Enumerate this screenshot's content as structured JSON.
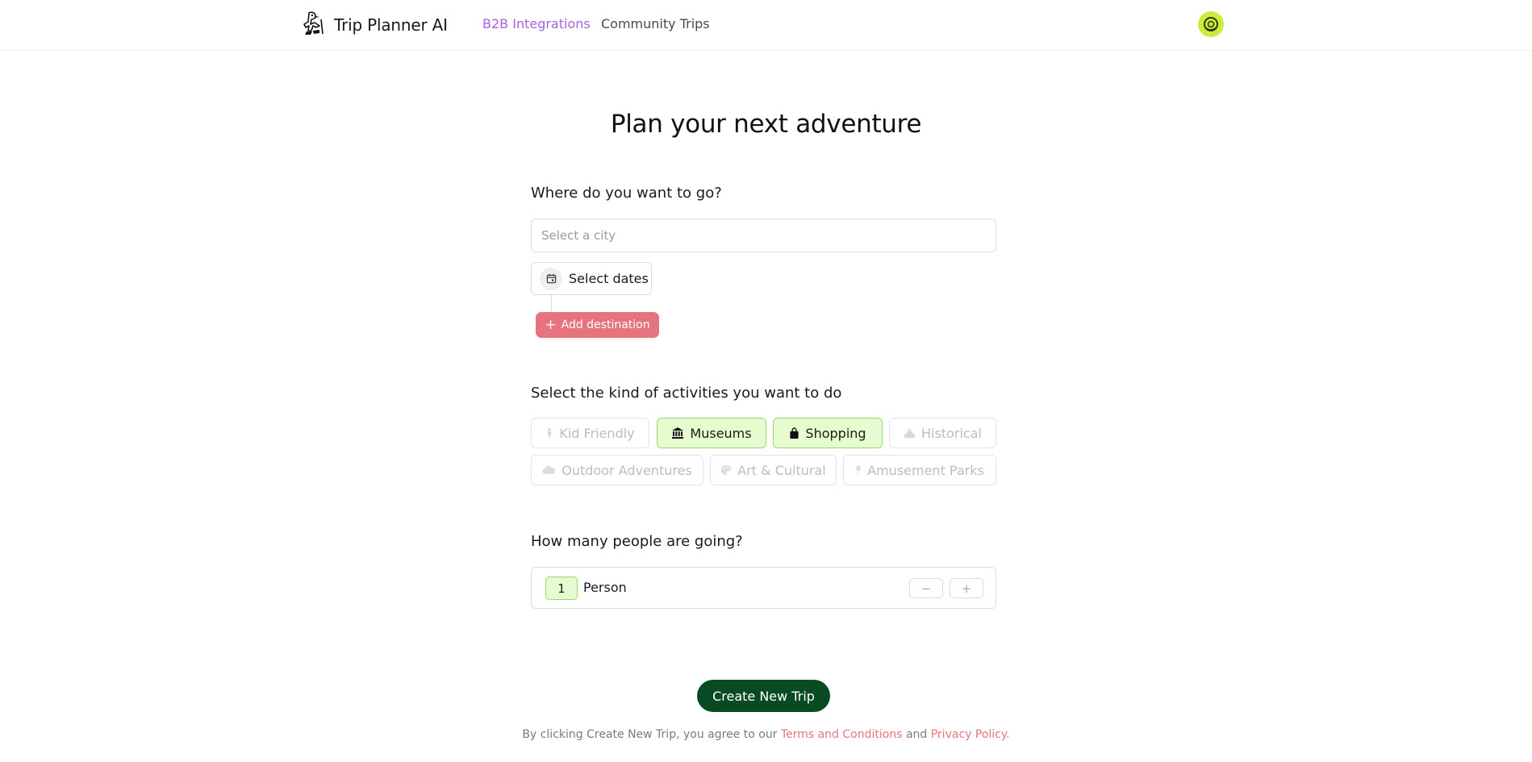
{
  "header": {
    "app_name": "Trip Planner AI",
    "logo_icon": "hiking-bird-logo-icon",
    "nav": [
      {
        "label": "B2B Integrations",
        "color": "#a463e0",
        "active": true
      },
      {
        "label": "Community Trips",
        "color": "#4a4a4a",
        "active": false
      }
    ],
    "avatar_icon": "user-avatar-icon",
    "avatar_color": "#c9ec3d"
  },
  "main": {
    "title": "Plan your next adventure",
    "destination": {
      "label": "Where do you want to go?",
      "city_placeholder": "Select a city",
      "city_value": "",
      "dates_label": "Select dates",
      "dates_icon": "calendar-icon",
      "add_destination_label": "Add destination",
      "add_destination_color": "#e5747f"
    },
    "activities": {
      "label": "Select the kind of activities you want to do",
      "options": [
        {
          "label": "Kid Friendly",
          "icon": "child-icon",
          "selected": false
        },
        {
          "label": "Museums",
          "icon": "museum-icon",
          "selected": true
        },
        {
          "label": "Shopping",
          "icon": "shopping-bag-icon",
          "selected": true
        },
        {
          "label": "Historical",
          "icon": "monument-icon",
          "selected": false
        },
        {
          "label": "Outdoor Adventures",
          "icon": "cloud-icon",
          "selected": false
        },
        {
          "label": "Art & Cultural",
          "icon": "palette-icon",
          "selected": false
        },
        {
          "label": "Amusement Parks",
          "icon": "balloon-icon",
          "selected": false
        }
      ],
      "selected_color": "#e6fcd0"
    },
    "people": {
      "label": "How many people are going?",
      "count": "1",
      "unit_label": "Person",
      "decrement_label": "−",
      "increment_label": "+"
    },
    "create_button_label": "Create New Trip",
    "create_button_color": "#0a4a22",
    "disclaimer": {
      "prefix": "By clicking Create New Trip, you agree to our",
      "terms_label": "Terms and Conditions",
      "and": "and",
      "privacy_label": "Privacy Policy",
      "suffix": "."
    }
  }
}
